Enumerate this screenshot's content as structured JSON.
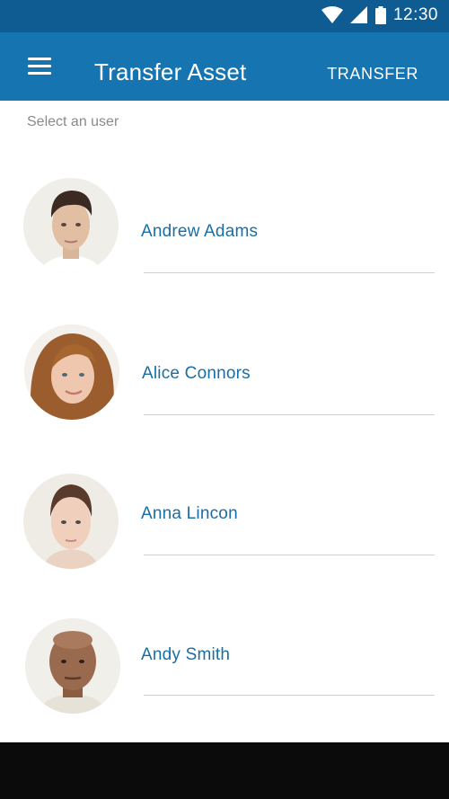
{
  "status_bar": {
    "time": "12:30",
    "icons": [
      "wifi-icon",
      "signal-icon",
      "battery-icon"
    ]
  },
  "app_bar": {
    "title": "Transfer Asset",
    "action_label": "TRANSFER",
    "menu_icon": "menu-icon"
  },
  "hint": "Select an user",
  "users": [
    {
      "name": "Andrew Adams"
    },
    {
      "name": "Alice Connors"
    },
    {
      "name": "Anna Lincon"
    },
    {
      "name": "Andy Smith"
    }
  ],
  "colors": {
    "status_bar": "#0f5c92",
    "app_bar": "#1674b1",
    "name_text": "#1a6ea6",
    "nav_bar": "#0b0b0b"
  }
}
